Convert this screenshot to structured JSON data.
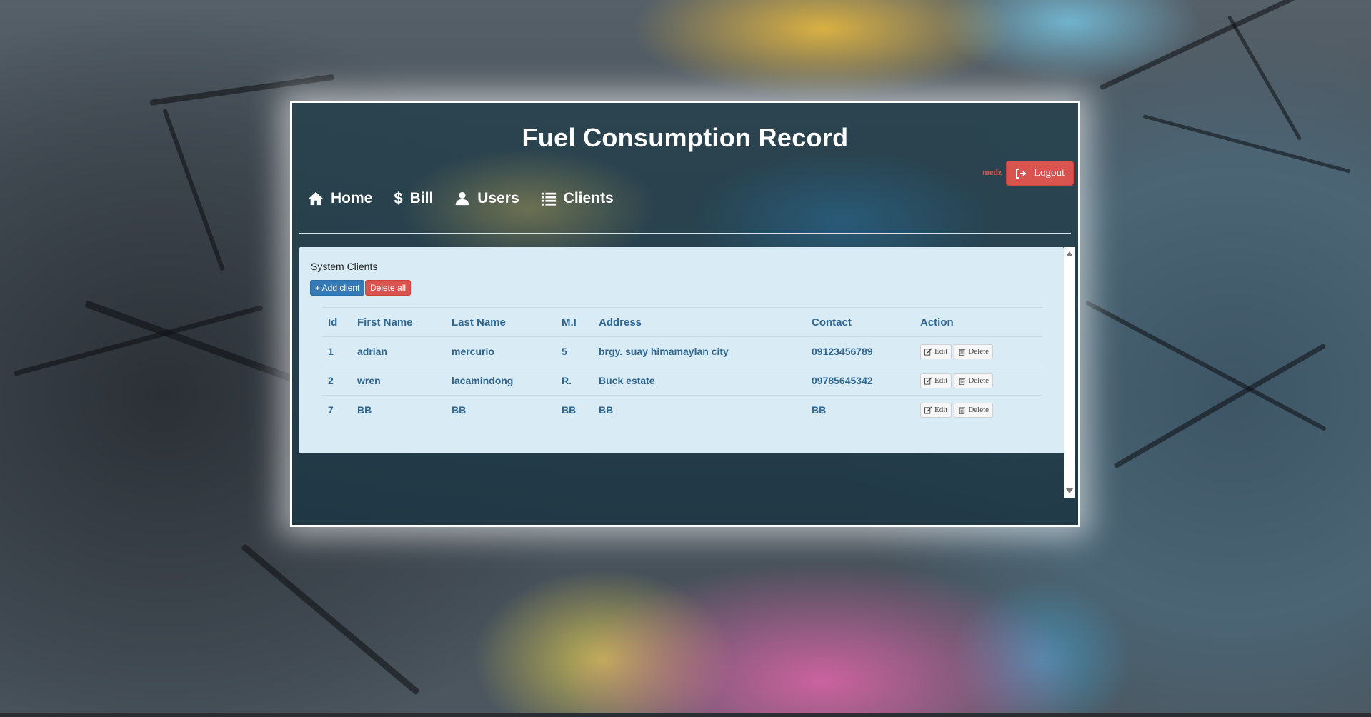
{
  "app": {
    "title": "Fuel Consumption Record",
    "username": "medz",
    "logout_label": "Logout"
  },
  "nav": {
    "items": [
      {
        "label": "Home",
        "icon": "home-icon"
      },
      {
        "label": "Bill",
        "icon": "dollar-icon"
      },
      {
        "label": "Users",
        "icon": "user-icon"
      },
      {
        "label": "Clients",
        "icon": "list-icon"
      }
    ]
  },
  "clients": {
    "section_title": "System Clients",
    "add_label": "+ Add client",
    "delete_all_label": "Delete all",
    "columns": [
      "Id",
      "First Name",
      "Last Name",
      "M.I",
      "Address",
      "Contact",
      "Action"
    ],
    "rows": [
      {
        "id": "1",
        "first": "adrian",
        "last": "mercurio",
        "mi": "5",
        "address": "brgy. suay himamaylan city",
        "contact": "09123456789"
      },
      {
        "id": "2",
        "first": "wren",
        "last": "lacamindong",
        "mi": "R.",
        "address": "Buck estate",
        "contact": "09785645342"
      },
      {
        "id": "7",
        "first": "BB",
        "last": "BB",
        "mi": "BB",
        "address": "BB",
        "contact": "BB"
      }
    ],
    "edit_label": "Edit",
    "delete_label": "Delete"
  },
  "colors": {
    "danger": "#d9534f",
    "primary": "#337ab7",
    "table_text": "#2f6690",
    "content_bg": "#d9ecf5"
  }
}
